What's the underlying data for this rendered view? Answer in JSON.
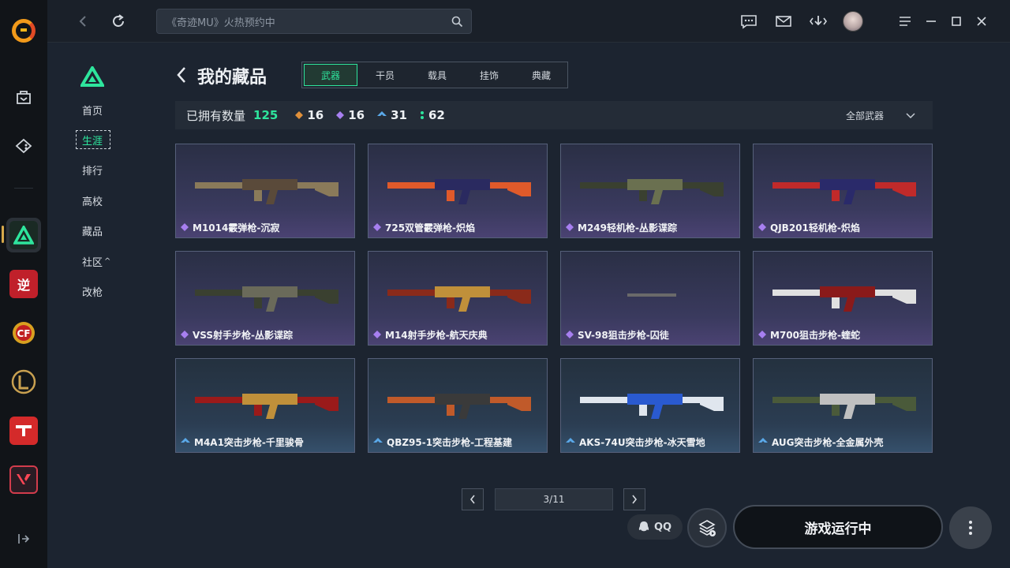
{
  "topbar": {
    "search_placeholder": "《奇迹MU》火热预约中"
  },
  "subnav": {
    "items": [
      {
        "label": "首页",
        "active": false
      },
      {
        "label": "生涯",
        "active": true
      },
      {
        "label": "排行",
        "active": false
      },
      {
        "label": "高校",
        "active": false
      },
      {
        "label": "藏品",
        "active": false
      },
      {
        "label": "社区",
        "active": false
      },
      {
        "label": "改枪",
        "active": false
      }
    ],
    "community_caret": "^"
  },
  "header": {
    "title": "我的藏品",
    "tabs": [
      "武器",
      "干员",
      "载具",
      "挂饰",
      "典藏"
    ],
    "active_tab": "武器"
  },
  "stats": {
    "label": "已拥有数量",
    "total": "125",
    "orange": "16",
    "purple": "16",
    "blue": "31",
    "green": "62",
    "filter_label": "全部武器"
  },
  "items": [
    {
      "name": "M1014霰弹枪-沉寂",
      "rarity": "purple"
    },
    {
      "name": "725双管霰弹枪-炽焰",
      "rarity": "purple"
    },
    {
      "name": "M249轻机枪-丛影谍踪",
      "rarity": "purple"
    },
    {
      "name": "QJB201轻机枪-炽焰",
      "rarity": "purple"
    },
    {
      "name": "VSS射手步枪-丛影谍踪",
      "rarity": "purple"
    },
    {
      "name": "M14射手步枪-航天庆典",
      "rarity": "purple"
    },
    {
      "name": "SV-98狙击步枪-囚徒",
      "rarity": "purple"
    },
    {
      "name": "M700狙击步枪-蝰蛇",
      "rarity": "purple"
    },
    {
      "name": "M4A1突击步枪-千里骏骨",
      "rarity": "blue"
    },
    {
      "name": "QBZ95-1突击步枪-工程基建",
      "rarity": "blue"
    },
    {
      "name": "AKS-74U突击步枪-冰天雪地",
      "rarity": "blue"
    },
    {
      "name": "AUG突击步枪-全金属外壳",
      "rarity": "blue"
    }
  ],
  "pager": {
    "text": "3/11"
  },
  "actions": {
    "qq_label": "QQ",
    "play_label": "游戏运行中"
  },
  "rail_games": {
    "tile1_glyph": "逆"
  },
  "colors": {
    "accent": "#2ee59d",
    "rarity_orange": "#e0903a",
    "rarity_purple": "#a77ff0",
    "rarity_blue": "#5aa8e8",
    "rarity_green": "#2ee59d"
  }
}
